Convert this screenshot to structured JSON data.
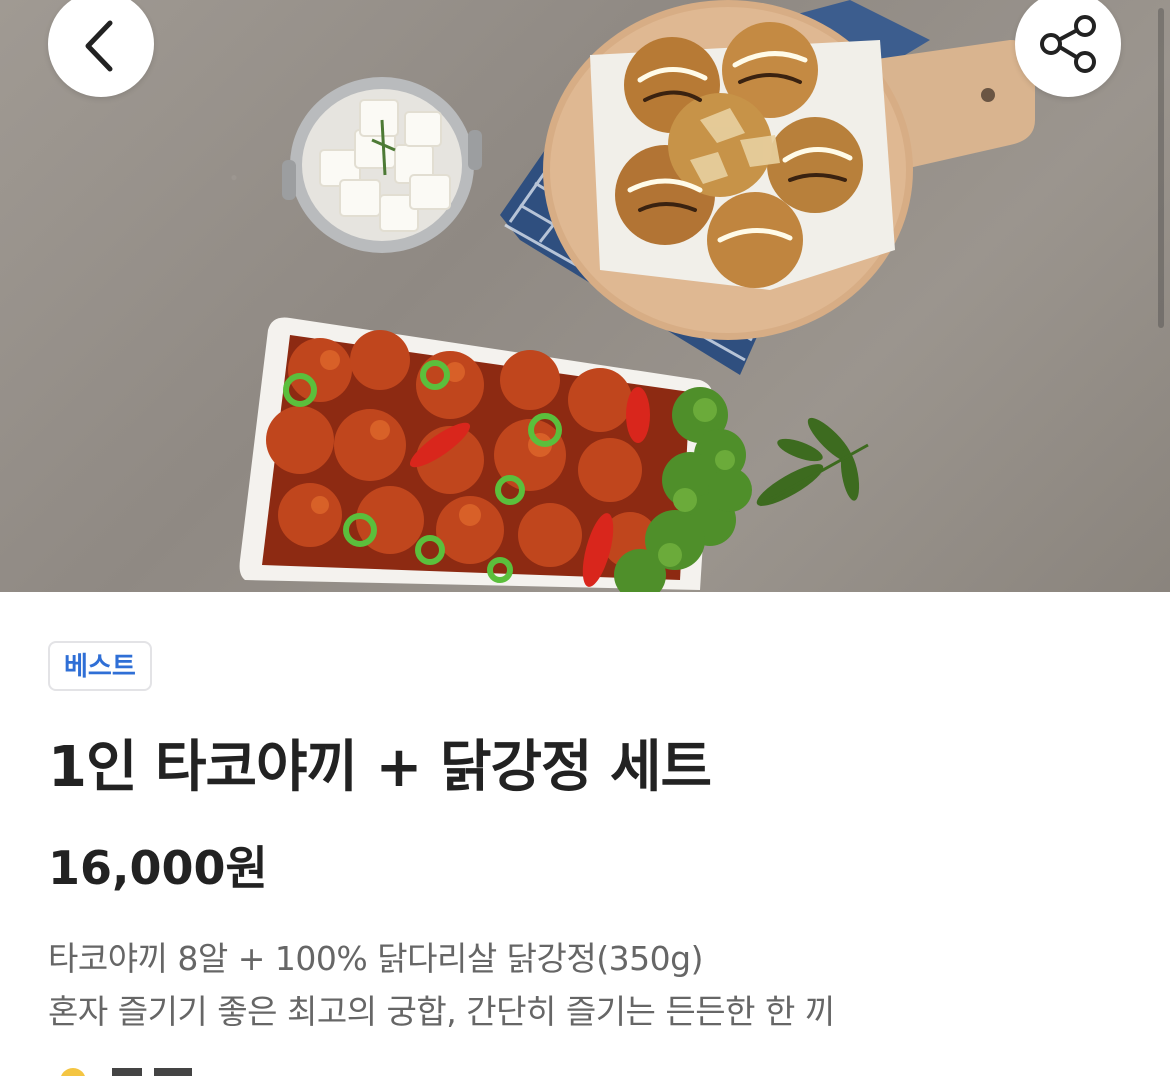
{
  "header": {
    "back_icon": "chevron-left-icon",
    "share_icon": "share-icon"
  },
  "hero": {
    "image_alt": "food-photo"
  },
  "product": {
    "badge": "베스트",
    "title": "1인 타코야끼 + 닭강정 세트",
    "price": "16,000원",
    "description_line1": "타코야끼 8알 + 100% 닭다리살 닭강정(350g)",
    "description_line2": "혼자 즐기기 좋은 최고의 궁합, 간단히 즐기는 든든한 한 끼"
  },
  "colors": {
    "badge_text": "#2f6fd6",
    "title": "#222222",
    "description": "#666666"
  }
}
